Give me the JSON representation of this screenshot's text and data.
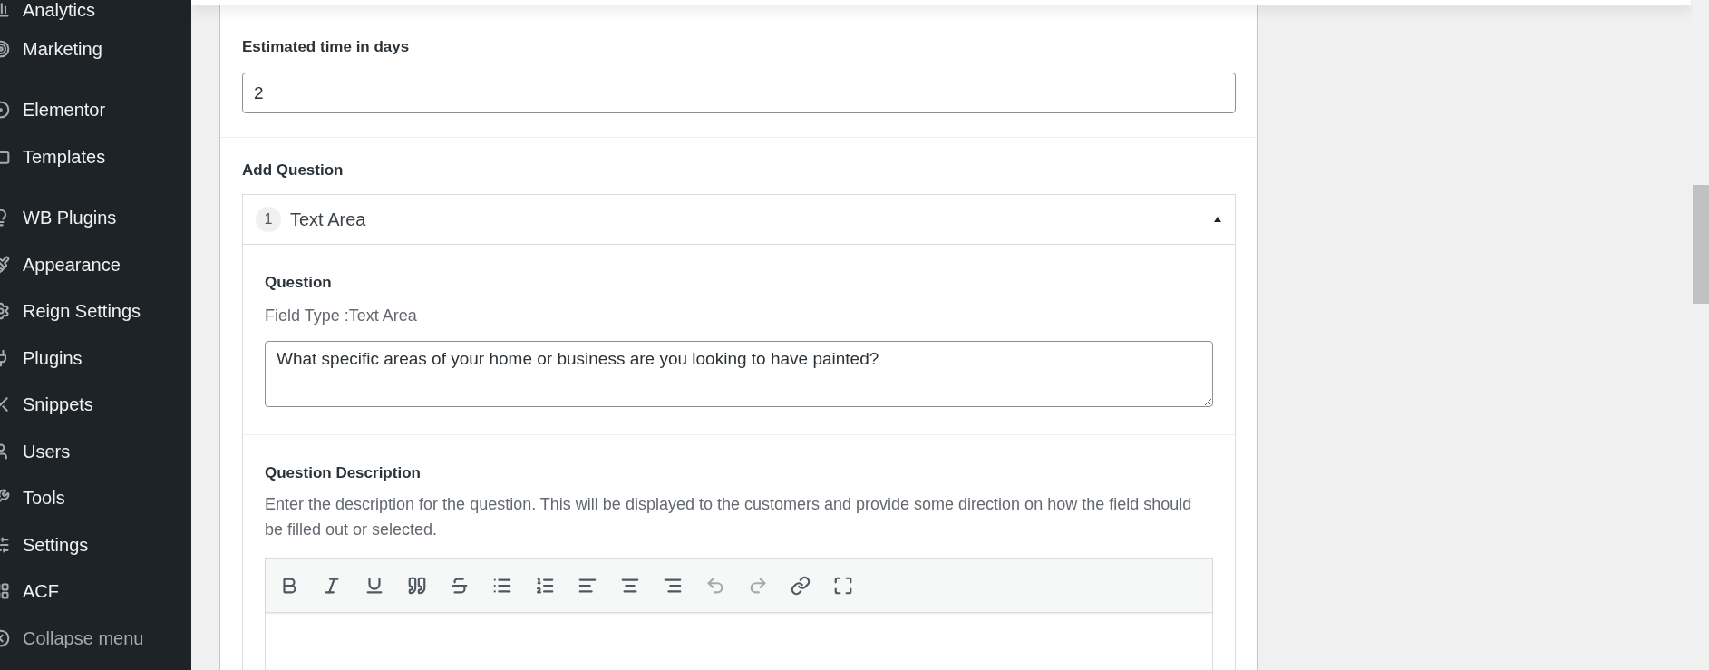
{
  "sidebar": {
    "groups": [
      {
        "items": [
          {
            "label": "Analytics",
            "selected": false
          },
          {
            "label": "Marketing",
            "selected": false
          }
        ]
      },
      {
        "items": [
          {
            "label": "Elementor",
            "selected": false
          },
          {
            "label": "Templates",
            "selected": false
          }
        ]
      },
      {
        "items": [
          {
            "label": "WB Plugins",
            "selected": false
          },
          {
            "label": "Appearance",
            "selected": false
          },
          {
            "label": "Reign Settings",
            "selected": false
          },
          {
            "label": "Plugins",
            "selected": false
          },
          {
            "label": "Snippets",
            "selected": false
          },
          {
            "label": "Users",
            "selected": false
          },
          {
            "label": "Tools",
            "selected": false
          },
          {
            "label": "Settings",
            "selected": false
          },
          {
            "label": "ACF",
            "selected": false
          },
          {
            "label": "Collapse menu",
            "selected": false,
            "kind": "collapse"
          }
        ]
      }
    ]
  },
  "form": {
    "estimated_label": "Estimated time in days",
    "estimated_value": "2",
    "add_question_label": "Add Question",
    "question": {
      "number": "1",
      "title": "Text Area",
      "expanded": true,
      "question_label": "Question",
      "field_type": "Field Type :Text Area",
      "question_value": "What specific areas of your home or business are you looking to have painted?",
      "description_label": "Question Description",
      "description_help": "Enter the description for the question. This will be displayed to the customers and provide some direction on how the field should be filled out or selected.",
      "toolbar": [
        {
          "disabled": false
        },
        {
          "disabled": false
        },
        {
          "disabled": false
        },
        {
          "disabled": false
        },
        {
          "disabled": false
        },
        {
          "disabled": false
        },
        {
          "disabled": false
        },
        {
          "disabled": false
        },
        {
          "disabled": false
        },
        {
          "disabled": false
        },
        {
          "disabled": true
        },
        {
          "disabled": true
        },
        {
          "disabled": false
        },
        {
          "disabled": false
        }
      ]
    }
  }
}
